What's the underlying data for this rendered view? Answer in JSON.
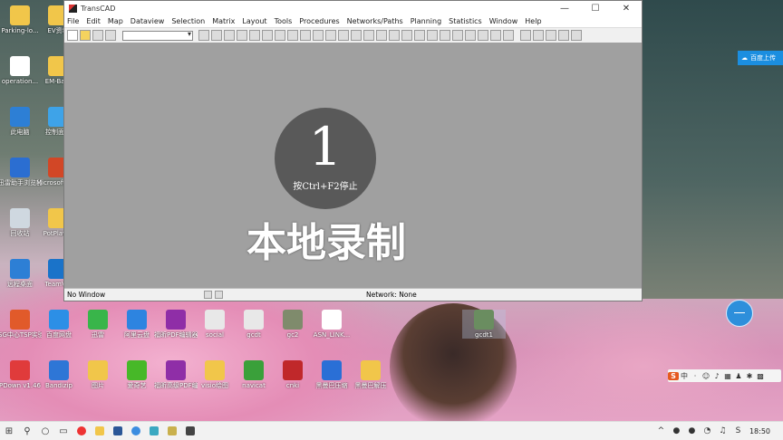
{
  "desktop": {
    "icons_left": [
      {
        "label": "Parking-lo...",
        "color": "#f1c64a"
      },
      {
        "label": "EV资料",
        "color": "#f1c64a"
      },
      {
        "label": "operation...",
        "color": "#ffffff"
      },
      {
        "label": "EM-Ba...",
        "color": "#f1c64a"
      },
      {
        "label": "此电脑",
        "color": "#2d7fd5"
      },
      {
        "label": "控制面板",
        "color": "#3ea3e8"
      },
      {
        "label": "迅雷助手浏览器",
        "color": "#2b6ed1"
      },
      {
        "label": "Microsoft PowerP...",
        "color": "#d24726"
      },
      {
        "label": "回收站",
        "color": "#cfd8e0"
      },
      {
        "label": "PotPlayer",
        "color": "#f1c64a"
      },
      {
        "label": "远程桌面",
        "color": "#2d7fd5"
      },
      {
        "label": "TeamV...",
        "color": "#1a73c9"
      }
    ],
    "icons_row1": [
      {
        "label": "SG中心TSP实验助手",
        "color": "#e15a2a"
      },
      {
        "label": "百度网盘",
        "color": "#2c8fe6"
      },
      {
        "label": "迅雷",
        "color": "#39b54a"
      },
      {
        "label": "阿里云盘",
        "color": "#2d84e0"
      },
      {
        "label": "福昕PDF编辑器",
        "color": "#8f2ea7"
      },
      {
        "label": "social",
        "color": "#e8e8e8"
      },
      {
        "label": "gcdt",
        "color": "#e8e8e8"
      },
      {
        "label": "gc2",
        "color": "#7f8b6c"
      },
      {
        "label": "ASN_LINK...",
        "color": "#ffffff"
      },
      {
        "label": "gcdt1",
        "color": "#6a8d60"
      }
    ],
    "icons_row2": [
      {
        "label": "PDown v1.46",
        "color": "#e03b3b"
      },
      {
        "label": "Bandizip",
        "color": "#2e76d6"
      },
      {
        "label": "图片",
        "color": "#f1c64a"
      },
      {
        "label": "爱奇艺",
        "color": "#47b828"
      },
      {
        "label": "福昕高级PDF编辑器",
        "color": "#8f2ea7"
      },
      {
        "label": "visio绘图",
        "color": "#f1c64a"
      },
      {
        "label": "navicat",
        "color": "#3aa03a"
      },
      {
        "label": "cnki",
        "color": "#c0282a"
      },
      {
        "label": "黑曼巴压缩",
        "color": "#2a6fd6"
      },
      {
        "label": "黑曼巴解压",
        "color": "#f1c64a"
      }
    ]
  },
  "window": {
    "title": "TransCAD",
    "minimize": "—",
    "maximize": "☐",
    "close": "✕",
    "menu": [
      "File",
      "Edit",
      "Map",
      "Dataview",
      "Selection",
      "Matrix",
      "Layout",
      "Tools",
      "Procedures",
      "Networks/Paths",
      "Planning",
      "Statistics",
      "Window",
      "Help"
    ],
    "combo_value": "",
    "status_left": "No Window",
    "status_right": "Network: None"
  },
  "recording": {
    "countdown": "1",
    "hint": "按Ctrl+F2停止",
    "label": "本地录制"
  },
  "cloud_upload": {
    "label": "百度上传"
  },
  "ime": {
    "logo": "S",
    "mode": "中"
  },
  "taskbar": {
    "time": "18:50"
  },
  "icons": {
    "start": "windows-logo-icon",
    "search": "search-icon",
    "cortana": "circle-icon",
    "taskview": "task-view-icon"
  }
}
